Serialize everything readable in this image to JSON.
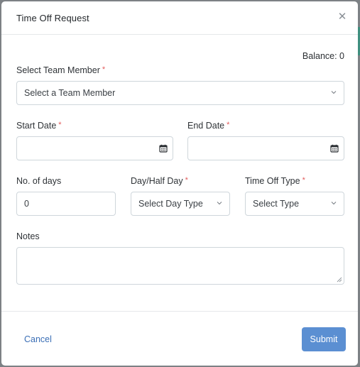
{
  "modal": {
    "title": "Time Off Request",
    "close_icon": "close-icon",
    "balance_text": "Balance: 0"
  },
  "form": {
    "team_member": {
      "label": "Select Team Member",
      "required_mark": "*",
      "value": "Select a Team Member"
    },
    "start_date": {
      "label": "Start Date",
      "required_mark": "*",
      "value": ""
    },
    "end_date": {
      "label": "End Date",
      "required_mark": "*",
      "value": ""
    },
    "num_days": {
      "label": "No. of days",
      "value": "0"
    },
    "day_type": {
      "label": "Day/Half Day",
      "required_mark": "*",
      "value": "Select Day Type"
    },
    "time_off_type": {
      "label": "Time Off Type",
      "required_mark": "*",
      "value": "Select Type"
    },
    "notes": {
      "label": "Notes",
      "value": ""
    }
  },
  "footer": {
    "cancel_label": "Cancel",
    "submit_label": "Submit"
  },
  "colors": {
    "accent": "#5b8fd2",
    "required": "#e25a5a",
    "link": "#3b6fb6"
  },
  "icons": [
    "close-icon",
    "chevron-down-icon",
    "calendar-icon",
    "resize-handle-icon"
  ]
}
